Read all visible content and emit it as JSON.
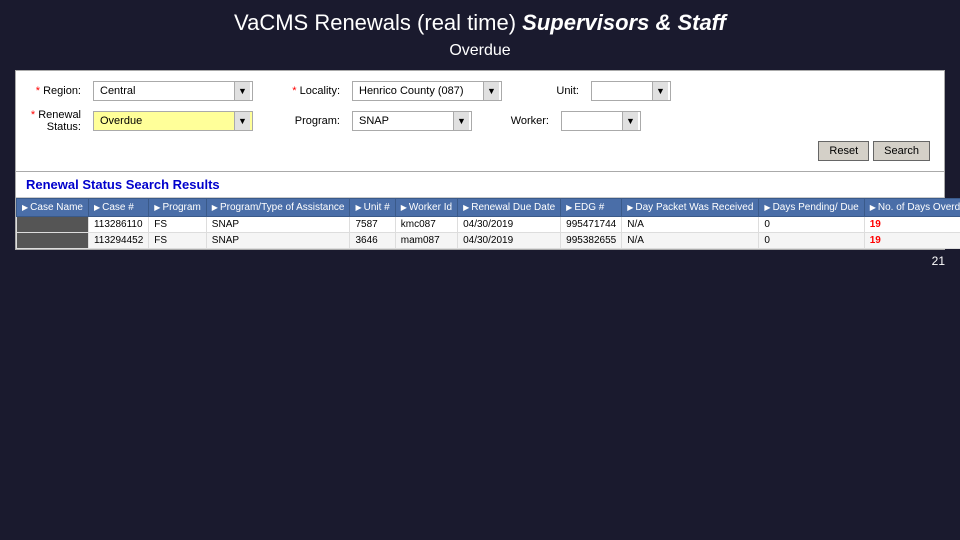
{
  "header": {
    "title_normal": "VaCMS Renewals (real time) ",
    "title_highlight": "Supervisors & Staff",
    "subtitle": "Overdue"
  },
  "form": {
    "region_label": "Region:",
    "region_value": "Central",
    "locality_label": "Locality:",
    "locality_value": "Henrico County (087)",
    "unit_label": "Unit:",
    "unit_value": "",
    "renewal_status_label": "Renewal Status:",
    "renewal_status_value": "Overdue",
    "program_label": "Program:",
    "program_value": "SNAP",
    "worker_label": "Worker:",
    "worker_value": "",
    "reset_btn": "Reset",
    "search_btn": "Search"
  },
  "results": {
    "section_title": "Renewal Status Search Results",
    "columns": [
      "Case Name",
      "Case #",
      "Program",
      "Program/Type of Assistance",
      "Unit #",
      "Worker Id",
      "Renewal Due Date",
      "EDG #",
      "Day Packet Was Received",
      "Days Pending/ Due",
      "No. of Days Overdue"
    ],
    "rows": [
      {
        "case_name": "",
        "case_num": "113286110",
        "program": "FS",
        "prog_type": "SNAP",
        "unit": "7587",
        "worker_id": "kmc087",
        "renewal_due": "04/30/2019",
        "edg": "995471744",
        "day_packet": "N/A",
        "days_pending": "0",
        "days_overdue": "19"
      },
      {
        "case_name": "",
        "case_num": "113294452",
        "program": "FS",
        "prog_type": "SNAP",
        "unit": "3646",
        "worker_id": "mam087",
        "renewal_due": "04/30/2019",
        "edg": "995382655",
        "day_packet": "N/A",
        "days_pending": "0",
        "days_overdue": "19"
      }
    ]
  },
  "page_number": "21"
}
